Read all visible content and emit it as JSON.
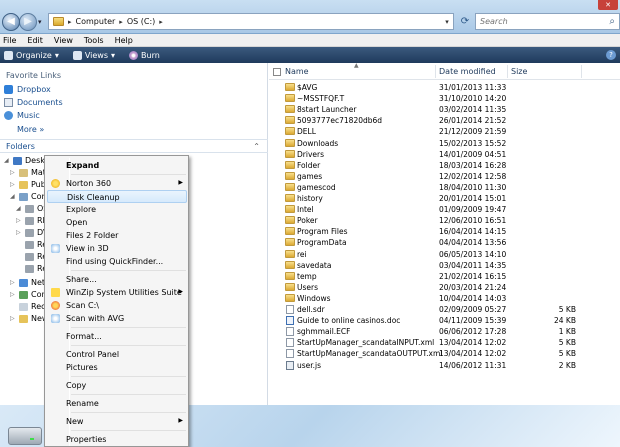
{
  "address": {
    "crumbs": [
      "Computer",
      "OS (C:)"
    ],
    "search_placeholder": "Search"
  },
  "menubar": [
    "File",
    "Edit",
    "View",
    "Tools",
    "Help"
  ],
  "toolbar": {
    "organize": "Organize",
    "views": "Views",
    "burn": "Burn"
  },
  "nav": {
    "favorites_header": "Favorite Links",
    "favorites": [
      "Dropbox",
      "Documents",
      "Music"
    ],
    "more": "More",
    "folders_label": "Folders",
    "tree": [
      "Desktop",
      "Matt",
      "Public",
      "Computer",
      "OS (C:)",
      "RE",
      "DV",
      "Re",
      "Re",
      "Re",
      "Network",
      "Control Panel",
      "Recycle Bin",
      "New"
    ]
  },
  "columns": {
    "name": "Name",
    "date": "Date modified",
    "size": "Size"
  },
  "files": [
    {
      "name": "$AVG",
      "date": "31/01/2013 11:33",
      "size": "",
      "type": "folder"
    },
    {
      "name": "~MSSTFQF.T",
      "date": "31/10/2010 14:20",
      "size": "",
      "type": "folder"
    },
    {
      "name": "8start Launcher",
      "date": "03/02/2014 11:35",
      "size": "",
      "type": "folder"
    },
    {
      "name": "5093777ec71820db6d",
      "date": "26/01/2014 21:52",
      "size": "",
      "type": "folder"
    },
    {
      "name": "DELL",
      "date": "21/12/2009 21:59",
      "size": "",
      "type": "folder"
    },
    {
      "name": "Downloads",
      "date": "15/02/2013 15:52",
      "size": "",
      "type": "folder"
    },
    {
      "name": "Drivers",
      "date": "14/01/2009 04:51",
      "size": "",
      "type": "folder"
    },
    {
      "name": "Folder",
      "date": "18/03/2014 16:28",
      "size": "",
      "type": "folder"
    },
    {
      "name": "games",
      "date": "12/02/2014 12:58",
      "size": "",
      "type": "folder"
    },
    {
      "name": "gamescod",
      "date": "18/04/2010 11:30",
      "size": "",
      "type": "folder"
    },
    {
      "name": "history",
      "date": "20/01/2014 15:01",
      "size": "",
      "type": "folder"
    },
    {
      "name": "Intel",
      "date": "01/09/2009 19:47",
      "size": "",
      "type": "folder"
    },
    {
      "name": "Poker",
      "date": "12/06/2010 16:51",
      "size": "",
      "type": "folder"
    },
    {
      "name": "Program Files",
      "date": "16/04/2014 14:15",
      "size": "",
      "type": "folder"
    },
    {
      "name": "ProgramData",
      "date": "04/04/2014 13:56",
      "size": "",
      "type": "folder"
    },
    {
      "name": "rei",
      "date": "06/05/2013 14:10",
      "size": "",
      "type": "folder"
    },
    {
      "name": "savedata",
      "date": "03/04/2011 14:35",
      "size": "",
      "type": "folder"
    },
    {
      "name": "temp",
      "date": "21/02/2014 16:15",
      "size": "",
      "type": "folder"
    },
    {
      "name": "Users",
      "date": "20/03/2014 21:24",
      "size": "",
      "type": "folder"
    },
    {
      "name": "Windows",
      "date": "10/04/2014 14:03",
      "size": "",
      "type": "folder"
    },
    {
      "name": "dell.sdr",
      "date": "02/09/2009 05:27",
      "size": "5 KB",
      "type": "file"
    },
    {
      "name": "Guide to online casinos.doc",
      "date": "04/11/2009 15:39",
      "size": "24 KB",
      "type": "doc"
    },
    {
      "name": "sghmmail.ECF",
      "date": "06/06/2012 17:28",
      "size": "1 KB",
      "type": "file"
    },
    {
      "name": "StartUpManager_scandataINPUT.xml",
      "date": "13/04/2014 12:02",
      "size": "5 KB",
      "type": "file"
    },
    {
      "name": "StartUpManager_scandataOUTPUT.xml",
      "date": "13/04/2014 12:02",
      "size": "5 KB",
      "type": "file"
    },
    {
      "name": "user.js",
      "date": "14/06/2012 11:31",
      "size": "2 KB",
      "type": "js"
    }
  ],
  "context_menu": {
    "expand": "Expand",
    "norton": "Norton 360",
    "disk_cleanup": "Disk Cleanup",
    "explore": "Explore",
    "open": "Open",
    "files2folder": "Files 2 Folder",
    "view3d": "View in 3D",
    "quickfinder": "Find using QuickFinder...",
    "share": "Share...",
    "winzip": "WinZip System Utilities Suite",
    "scan_c": "Scan C:\\",
    "scan_avg": "Scan with AVG",
    "format": "Format...",
    "control_panel": "Control Panel",
    "pictures": "Pictures",
    "copy": "Copy",
    "rename": "Rename",
    "new": "New",
    "properties": "Properties"
  }
}
